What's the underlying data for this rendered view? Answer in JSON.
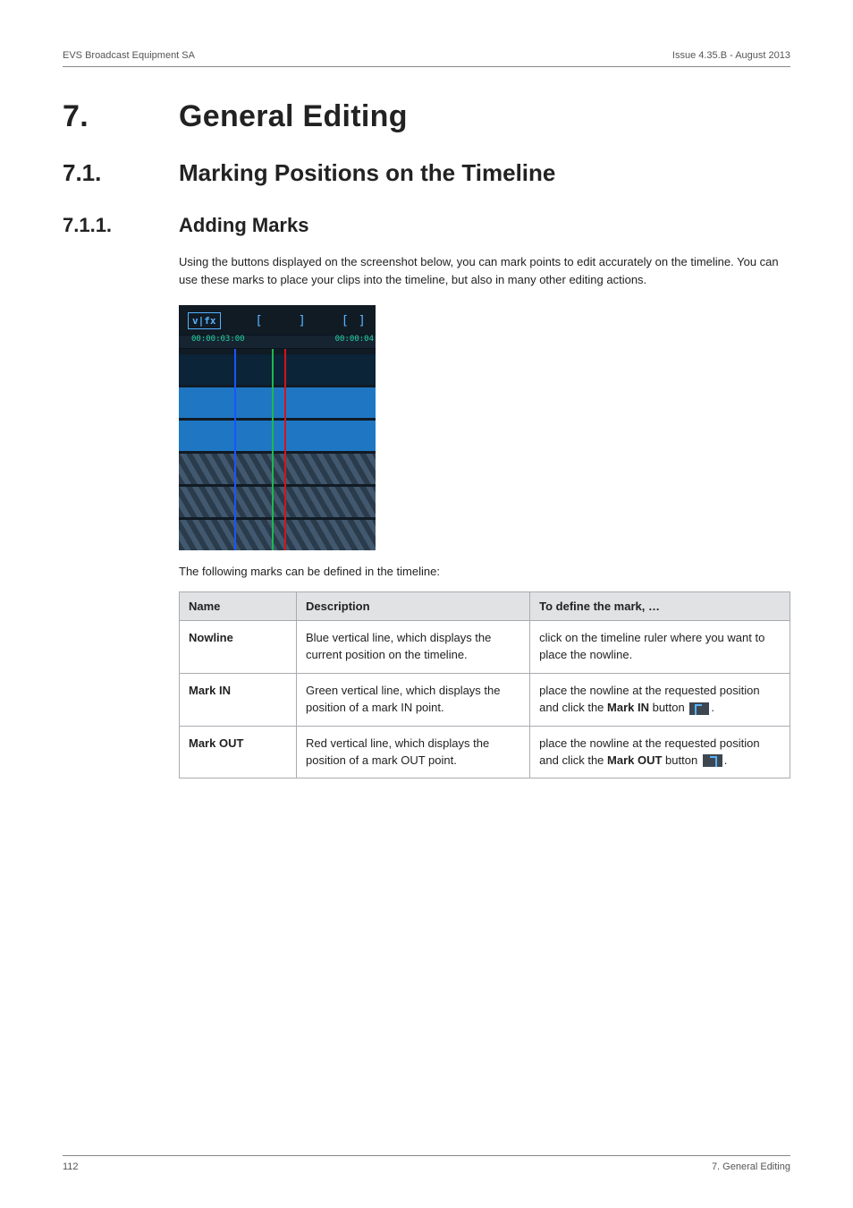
{
  "header": {
    "left": "EVS Broadcast Equipment SA",
    "right": "Issue 4.35.B - August 2013"
  },
  "h1": {
    "num": "7.",
    "title": "General Editing"
  },
  "h2": {
    "num": "7.1.",
    "title": "Marking Positions on the Timeline"
  },
  "h3": {
    "num": "7.1.1.",
    "title": "Adding Marks"
  },
  "intro": "Using the buttons displayed on the screenshot below, you can mark points to edit accurately on the timeline. You can use these marks to place your clips into the timeline, but also in many other editing actions.",
  "screenshot": {
    "vfx_label": "v|fx",
    "bracket_in": "[",
    "bracket_out": "]",
    "bracket_pair": "[ ]",
    "tc_left": "00:00:03:00",
    "tc_right": "00:00:04"
  },
  "caption": "The following marks can be defined in the timeline:",
  "table": {
    "headers": {
      "c1": "Name",
      "c2": "Description",
      "c3": "To define the mark, …"
    },
    "rows": [
      {
        "name": "Nowline",
        "desc": "Blue vertical line, which displays the current position on the timeline.",
        "def": "click on the timeline ruler where you want to place the nowline."
      },
      {
        "name": "Mark IN",
        "desc": "Green vertical line, which displays the position of a mark IN point.",
        "def_prefix": "place the nowline at the requested position and click the ",
        "def_bold": "Mark IN",
        "def_suffix": " button ",
        "def_end": "."
      },
      {
        "name": "Mark OUT",
        "desc": "Red vertical line, which displays the position of a mark OUT point.",
        "def_prefix": "place the nowline at the requested position and click the ",
        "def_bold": "Mark OUT",
        "def_suffix": " button ",
        "def_end": "."
      }
    ]
  },
  "footer": {
    "left": "112",
    "right": "7. General Editing"
  }
}
